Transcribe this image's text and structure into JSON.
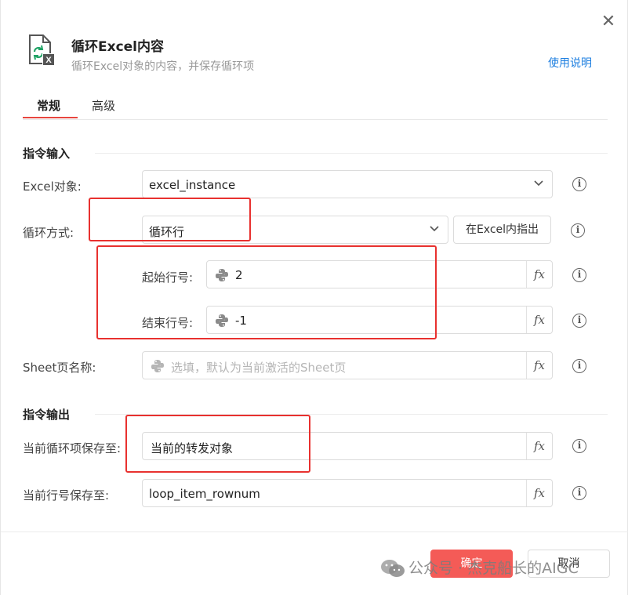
{
  "header": {
    "title": "循环Excel内容",
    "subtitle": "循环Excel对象的内容，并保存循环项",
    "help_link": "使用说明",
    "icon": "excel-loop-icon"
  },
  "tabs": [
    {
      "label": "常规",
      "active": true
    },
    {
      "label": "高级",
      "active": false
    }
  ],
  "input_section": {
    "title": "指令输入",
    "excel_object": {
      "label": "Excel对象:",
      "value": "excel_instance"
    },
    "loop_mode": {
      "label": "循环方式:",
      "value": "循环行",
      "button": "在Excel内指出"
    },
    "start_row": {
      "label": "起始行号:",
      "value": "2"
    },
    "end_row": {
      "label": "结束行号:",
      "value": "-1"
    },
    "sheet_name": {
      "label": "Sheet页名称:",
      "placeholder": "选填，默认为当前激活的Sheet页"
    }
  },
  "output_section": {
    "title": "指令输出",
    "loop_item": {
      "label": "当前循环项保存至:",
      "value": "当前的转发对象"
    },
    "row_num": {
      "label": "当前行号保存至:",
      "value": "loop_item_rownum"
    }
  },
  "footer": {
    "confirm": "确定",
    "cancel": "取消",
    "watermark": "公众号 · 杰克船长的AIGC"
  },
  "colors": {
    "accent": "#e8463f",
    "link": "#1e7fe0",
    "annotation": "#e8312f",
    "excel_green": "#21a366"
  }
}
